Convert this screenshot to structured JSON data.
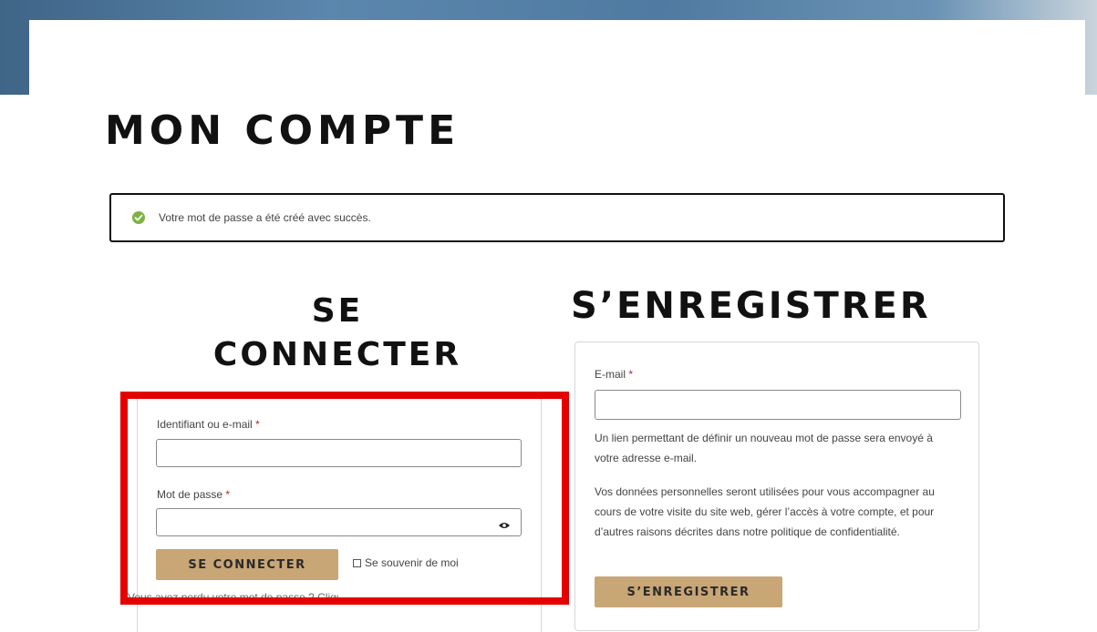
{
  "page": {
    "title": "MON COMPTE"
  },
  "notice": {
    "message": "Votre mot de passe a été créé avec succès."
  },
  "login": {
    "title_line1": "SE",
    "title_line2": "CONNECTER",
    "username_label": "Identifiant ou e-mail",
    "password_label": "Mot de passe",
    "required_mark": "*",
    "username_value": "",
    "password_value": "",
    "submit_label": "SE CONNECTER",
    "remember_label": "Se souvenir de moi",
    "remember_checked": false,
    "lost_password_text": "Vous avez perdu votre mot de passe ? Cliquez ici"
  },
  "register": {
    "title": "S’ENREGISTRER",
    "email_label": "E-mail",
    "required_mark": "*",
    "email_value": "",
    "info_text": "Un lien permettant de définir un nouveau mot de passe sera envoyé à votre adresse e-mail.",
    "privacy_text": "Vos données personnelles seront utilisées pour vous accompagner au cours de votre visite du site web, gérer l’accès à votre compte, et pour d’autres raisons décrites dans notre politique de confidentialité.",
    "submit_label": "S’ENREGISTRER"
  },
  "colors": {
    "accent_gold": "#c8a675",
    "highlight_red": "#e50000",
    "success_green": "#7cb342",
    "required_red": "#b0272e"
  },
  "icons": {
    "success": "check-circle-icon",
    "password_toggle": "eye-icon"
  }
}
